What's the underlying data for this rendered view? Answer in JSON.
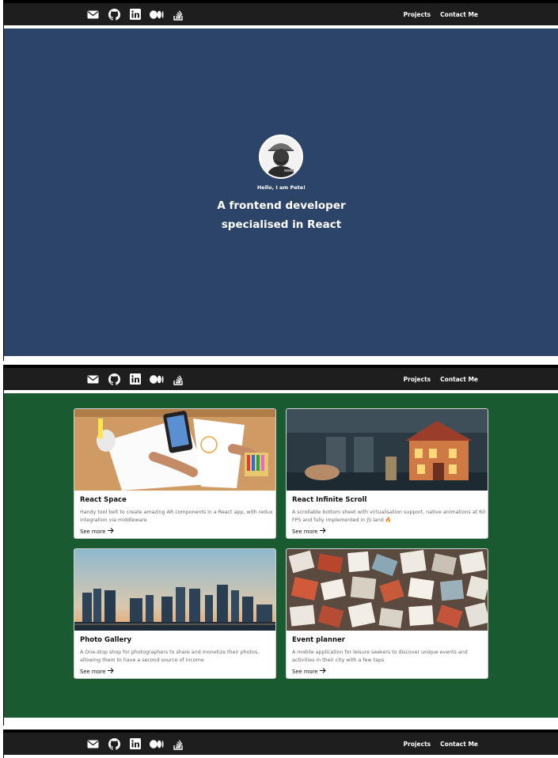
{
  "nav": {
    "icons": [
      "envelope-icon",
      "github-icon",
      "linkedin-icon",
      "medium-icon",
      "stackoverflow-icon"
    ],
    "links": [
      "Projects",
      "Contact Me"
    ]
  },
  "hero": {
    "hello": "Hello, I am Pete!",
    "tagline_line1": "A frontend developer",
    "tagline_line2": "specialised in React",
    "background": "#2c4467"
  },
  "projects": {
    "background": "#195a31",
    "cards": [
      {
        "title": "React Space",
        "description": "Handy tool belt to create amazing AR components in a React app, with redux integration via middleware",
        "link": "See more"
      },
      {
        "title": "React Infinite Scroll",
        "description": "A scrollable bottom sheet with virtualisation support, native animations at 60 FPS and fully implemented in JS land 🔥",
        "link": "See more"
      },
      {
        "title": "Photo Gallery",
        "description": "A One-stop shop for photographers to share and monetize their photos, allowing them to have a second source of income",
        "link": "See more"
      },
      {
        "title": "Event planner",
        "description": "A mobile application for leisure seekers to discover unique events and activities in their city with a few taps",
        "link": "See more"
      }
    ]
  }
}
